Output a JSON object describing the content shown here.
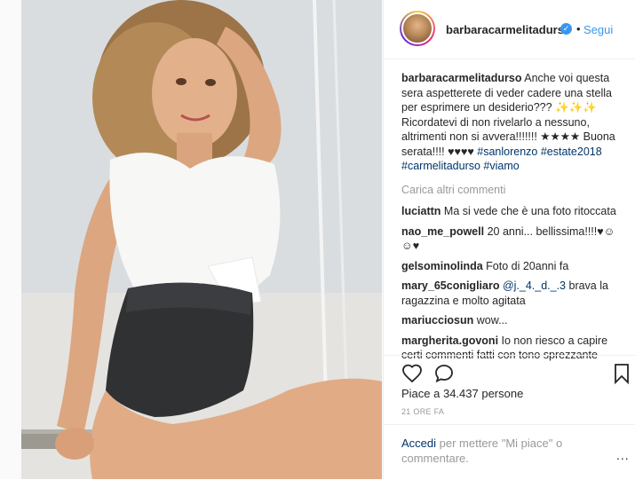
{
  "post": {
    "image_alt_name": "woman-on-swing-photo"
  },
  "header": {
    "username": "barbaracarmelitadurso",
    "dot": "•",
    "follow_label": "Segui"
  },
  "caption": {
    "username": "barbaracarmelitadurso",
    "text": " Anche voi questa sera aspetterete di veder cadere una stella per esprimere un desiderio??? ✨✨✨ Ricordatevi di non rivelarlo a nessuno, altrimenti non si avvera!!!!!!! ★★★★ Buona serata!!!! ♥♥♥♥ ",
    "tags": "#sanlorenzo #estate2018 #carmelitadurso #viamo"
  },
  "load_more": "Carica altri commenti",
  "comments": [
    {
      "user": "luciattn",
      "text": " Ma si vede che è una foto ritoccata"
    },
    {
      "user": "nao_me_powell",
      "text": " 20 anni... bellissima!!!!♥☺ ☺♥"
    },
    {
      "user": "gelsominolinda",
      "text": " Foto di 20anni fa"
    },
    {
      "user": "mary_65conigliaro",
      "mention": " @j._4._d._.3",
      "text": " brava la ragazzina e molto agitata"
    },
    {
      "user": "mariucciosun",
      "text": " wow..."
    },
    {
      "user": "margherita.govoni",
      "text": " Io non riesco a capire certi commenti fatti con tono sprezzante"
    }
  ],
  "likes": "Piace a 34.437 persone",
  "time": "21 ORE FA",
  "add_comment": {
    "link": "Accedi",
    "text": " per mettere \"Mi piace\" o commentare.",
    "more": "..."
  },
  "colors": {
    "accent": "#3897f0",
    "link": "#003569",
    "muted": "#999999"
  }
}
